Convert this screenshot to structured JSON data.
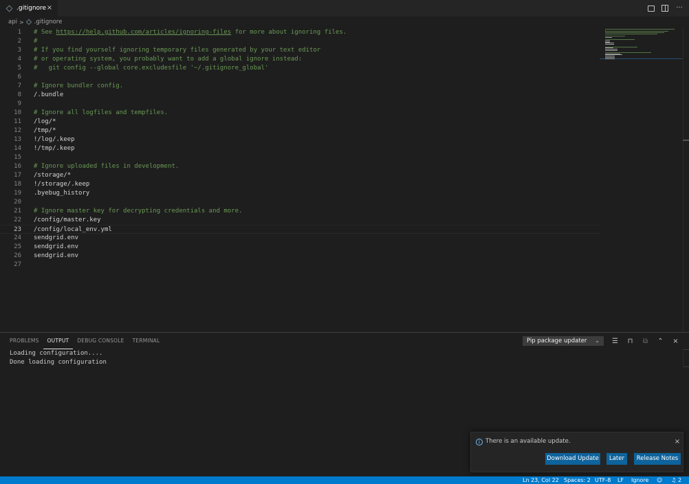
{
  "tab": {
    "label": ".gitignore",
    "close": "×"
  },
  "tab_actions": {
    "more": "···"
  },
  "breadcrumb": {
    "folder": "api",
    "separator": ">",
    "file": ".gitignore"
  },
  "editor": {
    "lines": [
      {
        "n": "1",
        "parts": [
          {
            "t": "# See ",
            "c": "cmt"
          },
          {
            "t": "https://help.github.com/articles/ignoring-files",
            "c": "lnk"
          },
          {
            "t": " for more about ignoring files.",
            "c": "cmt"
          }
        ]
      },
      {
        "n": "2",
        "parts": [
          {
            "t": "#",
            "c": "cmt"
          }
        ]
      },
      {
        "n": "3",
        "parts": [
          {
            "t": "# If you find yourself ignoring temporary files generated by your text editor",
            "c": "cmt"
          }
        ]
      },
      {
        "n": "4",
        "parts": [
          {
            "t": "# or operating system, you probably want to add a global ignore instead:",
            "c": "cmt"
          }
        ]
      },
      {
        "n": "5",
        "parts": [
          {
            "t": "#   git config --global core.excludesfile '~/.gitignore_global'",
            "c": "cmt"
          }
        ]
      },
      {
        "n": "6",
        "parts": []
      },
      {
        "n": "7",
        "parts": [
          {
            "t": "# Ignore bundler config.",
            "c": "cmt"
          }
        ]
      },
      {
        "n": "8",
        "parts": [
          {
            "t": "/.bundle",
            "c": ""
          }
        ]
      },
      {
        "n": "9",
        "parts": []
      },
      {
        "n": "10",
        "parts": [
          {
            "t": "# Ignore all logfiles and tempfiles.",
            "c": "cmt"
          }
        ]
      },
      {
        "n": "11",
        "parts": [
          {
            "t": "/log/*",
            "c": ""
          }
        ]
      },
      {
        "n": "12",
        "parts": [
          {
            "t": "/tmp/*",
            "c": ""
          }
        ]
      },
      {
        "n": "13",
        "parts": [
          {
            "t": "!/log/.keep",
            "c": ""
          }
        ]
      },
      {
        "n": "14",
        "parts": [
          {
            "t": "!/tmp/.keep",
            "c": ""
          }
        ]
      },
      {
        "n": "15",
        "parts": []
      },
      {
        "n": "16",
        "parts": [
          {
            "t": "# Ignore uploaded files in development.",
            "c": "cmt"
          }
        ]
      },
      {
        "n": "17",
        "parts": [
          {
            "t": "/storage/*",
            "c": ""
          }
        ]
      },
      {
        "n": "18",
        "parts": [
          {
            "t": "!/storage/.keep",
            "c": ""
          }
        ]
      },
      {
        "n": "19",
        "parts": [
          {
            "t": ".byebug_history",
            "c": ""
          }
        ]
      },
      {
        "n": "20",
        "parts": []
      },
      {
        "n": "21",
        "parts": [
          {
            "t": "# Ignore master key for decrypting credentials and more.",
            "c": "cmt"
          }
        ]
      },
      {
        "n": "22",
        "parts": [
          {
            "t": "/config/master.key",
            "c": ""
          }
        ]
      },
      {
        "n": "23",
        "parts": [
          {
            "t": "/config/local_env.yml",
            "c": ""
          }
        ],
        "active": true
      },
      {
        "n": "24",
        "parts": [
          {
            "t": "sendgrid.env",
            "c": ""
          }
        ]
      },
      {
        "n": "25",
        "parts": [
          {
            "t": "sendgrid.env",
            "c": ""
          }
        ]
      },
      {
        "n": "26",
        "parts": [
          {
            "t": "sendgrid.env",
            "c": ""
          }
        ]
      },
      {
        "n": "27",
        "parts": []
      }
    ]
  },
  "panel": {
    "tabs": [
      {
        "label": "PROBLEMS",
        "active": false
      },
      {
        "label": "OUTPUT",
        "active": true
      },
      {
        "label": "DEBUG CONSOLE",
        "active": false
      },
      {
        "label": "TERMINAL",
        "active": false
      }
    ],
    "channel_select": "Pip package updater",
    "output_lines": [
      "Loading configuration....",
      "Done loading configuration"
    ],
    "close": "×"
  },
  "notification": {
    "message": "There is an available update.",
    "info_glyph": "i",
    "close": "×",
    "buttons": {
      "download": "Download Update",
      "later": "Later",
      "release_notes": "Release Notes"
    }
  },
  "statusbar": {
    "position": "Ln 23, Col 22",
    "spaces": "Spaces: 2",
    "encoding": "UTF-8",
    "eol": "LF",
    "language": "Ignore",
    "notifications": "2"
  },
  "colors": {
    "accent": "#007acc",
    "button": "#0e639c",
    "comment": "#6a9955",
    "editor_bg": "#1e1e1e",
    "tabbar_bg": "#252526"
  }
}
